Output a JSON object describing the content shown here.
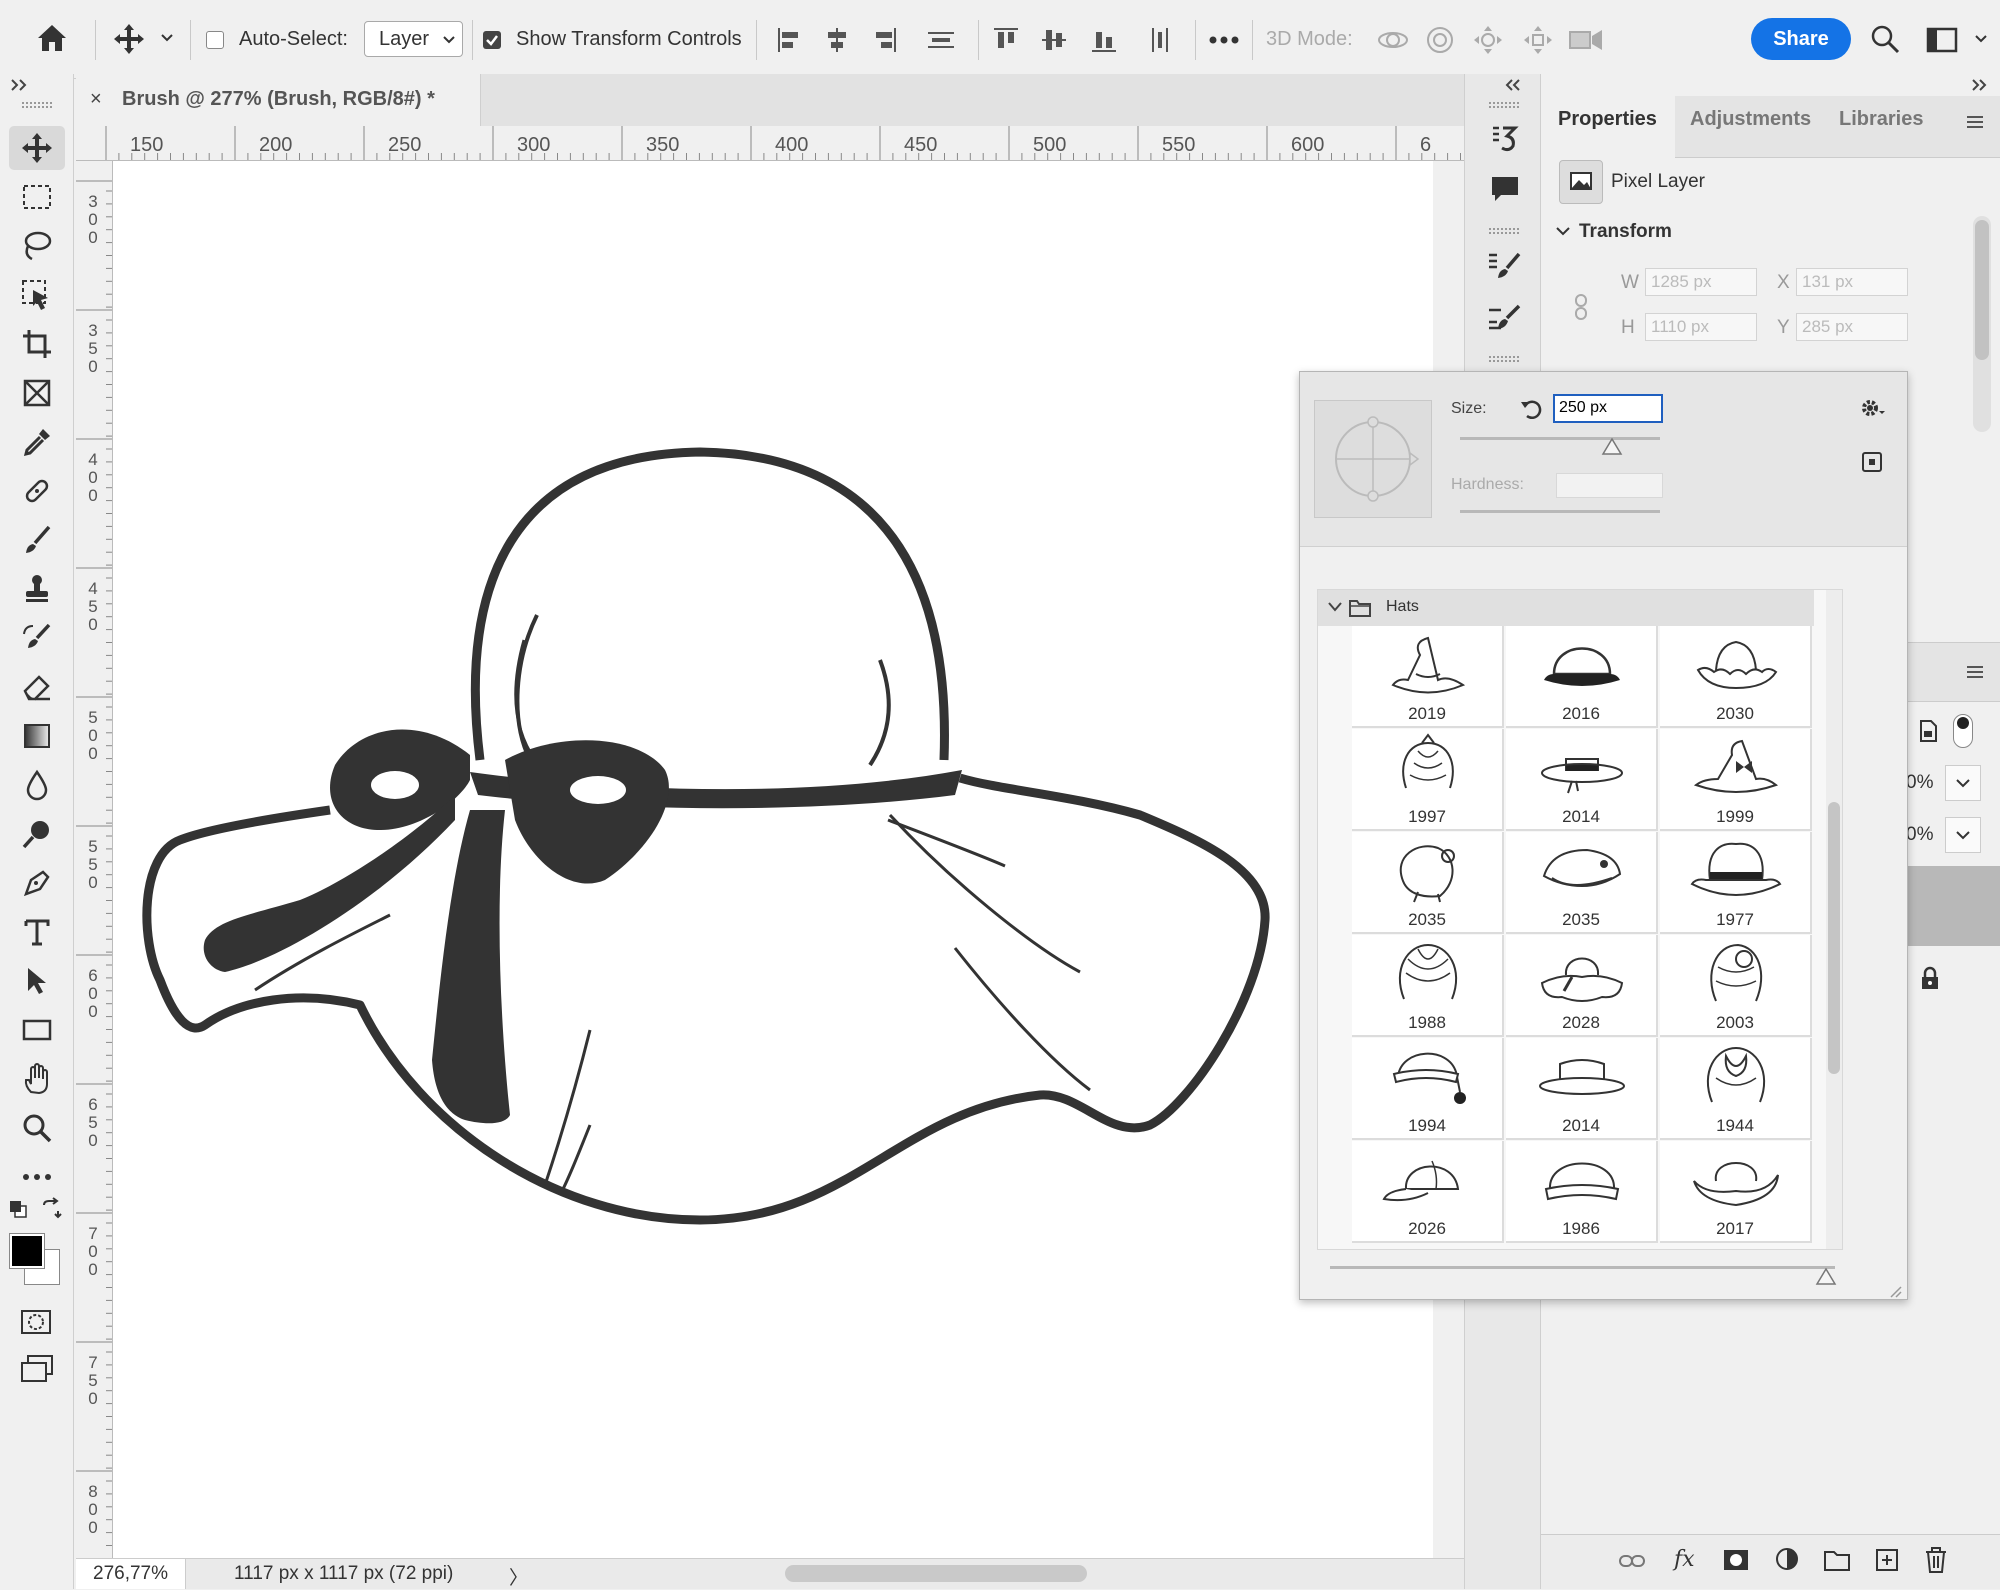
{
  "option_bar": {
    "auto_select_label": "Auto-Select:",
    "auto_select_checked": false,
    "layer_select_value": "Layer",
    "show_transform_label": "Show Transform Controls",
    "show_transform_checked": true,
    "mode_3d_label": "3D Mode:",
    "share_label": "Share"
  },
  "document": {
    "tab_close": "×",
    "tab_title": "Brush @ 277% (Brush, RGB/8#) *"
  },
  "rulers": {
    "horizontal": [
      "150",
      "200",
      "250",
      "300",
      "350",
      "400",
      "450",
      "500",
      "550",
      "600",
      "6"
    ],
    "vertical": [
      "300",
      "350",
      "400",
      "450",
      "500",
      "550",
      "600",
      "650",
      "700",
      "750",
      "800"
    ]
  },
  "status_bar": {
    "zoom": "276,77%",
    "dimensions": "1117 px x 1117 px (72 ppi)",
    "arrow": "〉"
  },
  "properties_panel": {
    "tabs": [
      "Properties",
      "Adjustments",
      "Libraries"
    ],
    "active_tab": "Properties",
    "layer_type": "Pixel Layer",
    "section_title": "Transform",
    "w_label": "W",
    "w_value": "1285 px",
    "h_label": "H",
    "h_value": "1110 px",
    "x_label": "X",
    "x_value": "131 px",
    "y_label": "Y",
    "y_value": "285 px",
    "percent_1": "0%",
    "percent_2": "0%"
  },
  "brush_picker": {
    "size_label": "Size:",
    "size_value": "250 px",
    "hardness_label": "Hardness:",
    "hardness_value": "",
    "folder_name": "Hats",
    "brushes": [
      {
        "label": "2019",
        "icon": "witch-hat-icon"
      },
      {
        "label": "2016",
        "icon": "bowler-hat-icon"
      },
      {
        "label": "2030",
        "icon": "frilled-bonnet-icon"
      },
      {
        "label": "1997",
        "icon": "headwrap-icon"
      },
      {
        "label": "2014",
        "icon": "boater-hat-icon"
      },
      {
        "label": "1999",
        "icon": "witch-hat-bow-icon"
      },
      {
        "label": "2035",
        "icon": "bonnet-icon"
      },
      {
        "label": "2035",
        "icon": "beret-icon"
      },
      {
        "label": "1977",
        "icon": "fedora-icon"
      },
      {
        "label": "1988",
        "icon": "turban-icon"
      },
      {
        "label": "2028",
        "icon": "floppy-hat-icon"
      },
      {
        "label": "2003",
        "icon": "headscarf-icon"
      },
      {
        "label": "1994",
        "icon": "nightcap-icon"
      },
      {
        "label": "2014",
        "icon": "bowler-brim-icon"
      },
      {
        "label": "1944",
        "icon": "turban-knot-icon"
      },
      {
        "label": "2026",
        "icon": "baseball-cap-icon"
      },
      {
        "label": "1986",
        "icon": "cap-front-icon"
      },
      {
        "label": "2017",
        "icon": "cowboy-hat-icon"
      }
    ]
  }
}
